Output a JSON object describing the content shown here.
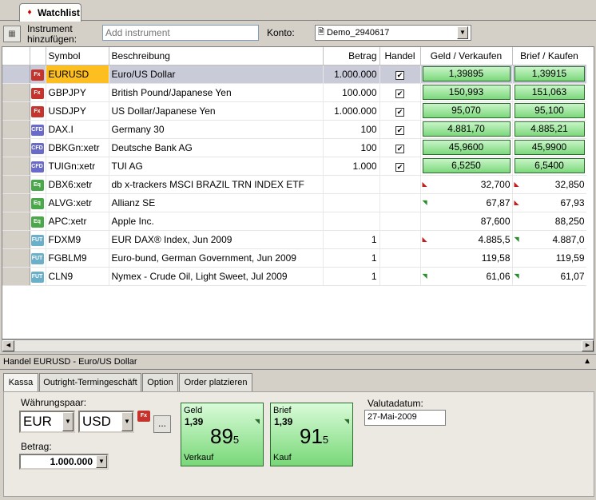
{
  "tab": {
    "title": "Watchlist"
  },
  "toolbar": {
    "add_label_1": "Instrument",
    "add_label_2": "hinzufügen:",
    "add_placeholder": "Add instrument",
    "konto_label": "Konto:",
    "konto_value": "Demo_2940617"
  },
  "grid": {
    "headers": {
      "symbol": "Symbol",
      "desc": "Beschreibung",
      "amount": "Betrag",
      "trade": "Handel",
      "bid": "Geld / Verkaufen",
      "ask": "Brief / Kaufen"
    },
    "rows": [
      {
        "badge": "Fx",
        "symbol": "EURUSD",
        "desc": "Euro/US Dollar",
        "amount": "1.000.000",
        "trade": true,
        "bid": "1,39895",
        "ask": "1,39915",
        "bid_btn": true,
        "bid_arrow": "",
        "ask_arrow": ""
      },
      {
        "badge": "Fx",
        "symbol": "GBPJPY",
        "desc": "British Pound/Japanese Yen",
        "amount": "100.000",
        "trade": true,
        "bid": "150,993",
        "ask": "151,063",
        "bid_btn": true,
        "bid_arrow": "",
        "ask_arrow": ""
      },
      {
        "badge": "Fx",
        "symbol": "USDJPY",
        "desc": "US Dollar/Japanese Yen",
        "amount": "1.000.000",
        "trade": true,
        "bid": "95,070",
        "ask": "95,100",
        "bid_btn": true,
        "bid_arrow": "",
        "ask_arrow": ""
      },
      {
        "badge": "CFD",
        "symbol": "DAX.I",
        "desc": "Germany 30",
        "amount": "100",
        "trade": true,
        "bid": "4.881,70",
        "ask": "4.885,21",
        "bid_btn": true,
        "bid_arrow": "",
        "ask_arrow": ""
      },
      {
        "badge": "CFD",
        "symbol": "DBKGn:xetr",
        "desc": "Deutsche Bank AG",
        "amount": "100",
        "trade": true,
        "bid": "45,9600",
        "ask": "45,9900",
        "bid_btn": true,
        "bid_arrow": "",
        "ask_arrow": ""
      },
      {
        "badge": "CFD",
        "symbol": "TUIGn:xetr",
        "desc": "TUI AG",
        "amount": "1.000",
        "trade": true,
        "bid": "6,5250",
        "ask": "6,5400",
        "bid_btn": true,
        "bid_arrow": "",
        "ask_arrow": ""
      },
      {
        "badge": "Eq",
        "symbol": "DBX6:xetr",
        "desc": "db x-trackers MSCI BRAZIL TRN INDEX ETF",
        "amount": "",
        "trade": false,
        "bid": "32,700",
        "ask": "32,850",
        "bid_btn": false,
        "bid_arrow": "down",
        "ask_arrow": "down"
      },
      {
        "badge": "Eq",
        "symbol": "ALVG:xetr",
        "desc": "Allianz SE",
        "amount": "",
        "trade": false,
        "bid": "67,87",
        "ask": "67,93",
        "bid_btn": false,
        "bid_arrow": "up",
        "ask_arrow": "down"
      },
      {
        "badge": "Eq",
        "symbol": "APC:xetr",
        "desc": "Apple Inc.",
        "amount": "",
        "trade": false,
        "bid": "87,600",
        "ask": "88,250",
        "bid_btn": false,
        "bid_arrow": "",
        "ask_arrow": ""
      },
      {
        "badge": "FUT",
        "symbol": "FDXM9",
        "desc": "EUR DAX® Index, Jun 2009",
        "amount": "1",
        "trade": false,
        "bid": "4.885,5",
        "ask": "4.887,0",
        "bid_btn": false,
        "bid_arrow": "down",
        "ask_arrow": "up"
      },
      {
        "badge": "FUT",
        "symbol": "FGBLM9",
        "desc": "Euro-bund, German Government, Jun 2009",
        "amount": "1",
        "trade": false,
        "bid": "119,58",
        "ask": "119,59",
        "bid_btn": false,
        "bid_arrow": "",
        "ask_arrow": ""
      },
      {
        "badge": "FUT",
        "symbol": "CLN9",
        "desc": "Nymex - Crude Oil, Light Sweet, Jul 2009",
        "amount": "1",
        "trade": false,
        "bid": "61,06",
        "ask": "61,07",
        "bid_btn": false,
        "bid_arrow": "up",
        "ask_arrow": "up"
      }
    ]
  },
  "panel": {
    "title": "Handel EURUSD - Euro/US Dollar",
    "tabs": [
      "Kassa",
      "Outright-Termingeschäft",
      "Option",
      "Order platzieren"
    ],
    "pair_label": "Währungspaar:",
    "pair_base": "EUR",
    "pair_quote": "USD",
    "pair_badge": "Fx",
    "more_btn": "...",
    "amount_label": "Betrag:",
    "amount_value": "1.000.000",
    "bid": {
      "label": "Geld",
      "pre": "1,39",
      "big": "89",
      "sub": "5",
      "foot": "Verkauf"
    },
    "ask": {
      "label": "Brief",
      "pre": "1,39",
      "big": "91",
      "sub": "5",
      "foot": "Kauf"
    },
    "valuta_label": "Valutadatum:",
    "valuta_value": "27-Mai-2009"
  },
  "colors": {
    "buy_green": "#7cd87c",
    "selected_symbol": "#fdbf20",
    "active_row": "#c9ccd8",
    "fx_badge": "#c4342c",
    "cfd_badge": "#6a6ac8",
    "eq_badge": "#4aa84a",
    "fut_badge": "#6bb0c8"
  }
}
